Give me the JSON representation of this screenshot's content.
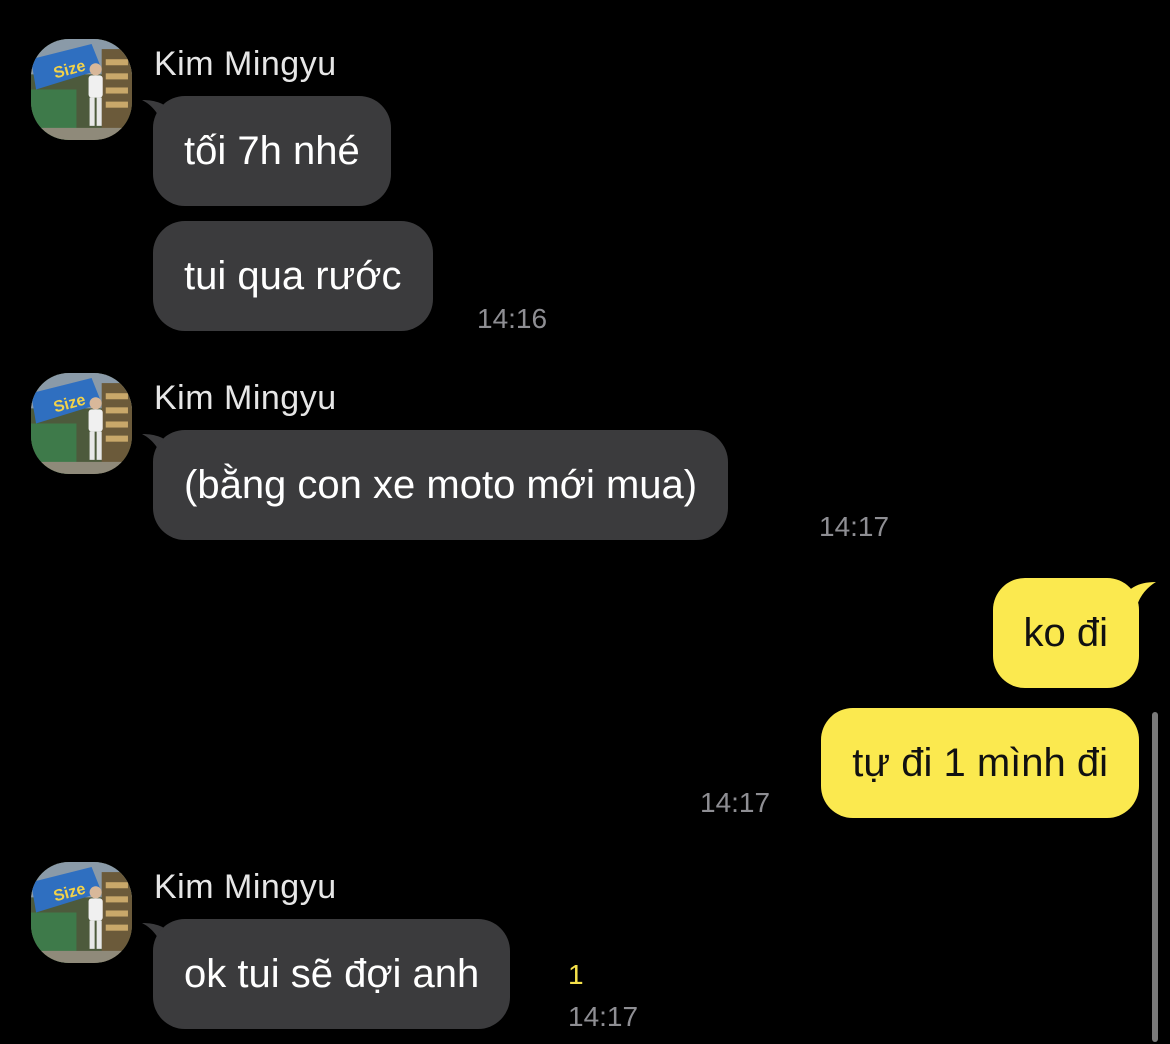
{
  "contact": {
    "name": "Kim Mingyu"
  },
  "groups": [
    {
      "sender": "Kim Mingyu",
      "messages": [
        "tối 7h nhé",
        "tui qua rước"
      ],
      "time": "14:16"
    },
    {
      "sender": "Kim Mingyu",
      "messages": [
        "(bằng con xe moto mới mua)"
      ],
      "time": "14:17"
    },
    {
      "sender": "me",
      "messages": [
        "ko đi",
        "tự đi 1 mình đi"
      ],
      "time": "14:17"
    },
    {
      "sender": "Kim Mingyu",
      "messages": [
        "ok tui sẽ đợi anh"
      ],
      "time": "14:17",
      "unread_count": "1"
    }
  ],
  "colors": {
    "background": "#000000",
    "incoming_bubble": "#3b3b3d",
    "outgoing_bubble": "#fbe94f",
    "timestamp": "#8e8e93",
    "unread": "#f5e14a"
  },
  "icons": {
    "avatar": "profile-photo-avatar"
  }
}
